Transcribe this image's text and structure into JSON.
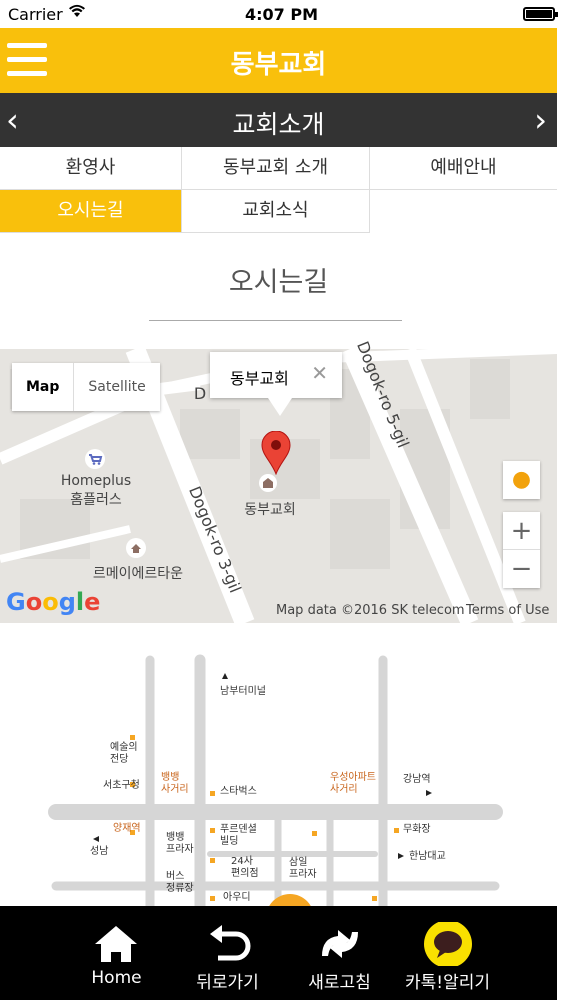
{
  "status_bar": {
    "carrier": "Carrier",
    "time": "4:07 PM"
  },
  "app_bar": {
    "title": "동부교회"
  },
  "sub_bar": {
    "title": "교회소개",
    "prev": "‹",
    "next": "›"
  },
  "tabs": [
    {
      "label": "환영사",
      "active": false
    },
    {
      "label": "동부교회 소개",
      "active": false
    },
    {
      "label": "예배안내",
      "active": false
    },
    {
      "label": "오시는길",
      "active": true
    },
    {
      "label": "교회소식",
      "active": false
    }
  ],
  "section": {
    "title": "오시는길"
  },
  "map": {
    "type_buttons": {
      "map": "Map",
      "satellite": "Satellite"
    },
    "info_window": {
      "name": "동부교회",
      "close": "✕"
    },
    "marker_label": "동부교회",
    "poi": {
      "homeplus_en": "Homeplus",
      "homeplus_ko": "홈플러스",
      "remei": "르메이에르타운"
    },
    "streets": {
      "s1": "Dogok-ro 3-gil",
      "s2": "Dogok-ro 5-gil",
      "s3": "D"
    },
    "zoom_in": "+",
    "zoom_out": "−",
    "google_logo": "Google",
    "attribution": "Map data ©2016 SK telecom",
    "terms": "Terms of Use"
  },
  "directions": {
    "labels": {
      "nambu": "남부터미널",
      "arts": "예술의\n전당",
      "seocho": "서초구청",
      "ppyeong_cross": "뱅뱅\n사거리",
      "starbucks": "스타벅스",
      "wooseong": "우성아파트\n사거리",
      "gangnam": "강남역",
      "yangjae": "양재역",
      "seongnam": "성남",
      "ppyeong_plaza": "뱅뱅\n프라자",
      "prudential": "푸르덴셜\n빌딩",
      "muhwajang": "무화장",
      "hannam": "한남대교",
      "conv": "24사\n편의점",
      "samil": "삼일\n프라자",
      "bus": "버스\n정류장",
      "audi": "아우디"
    }
  },
  "bottom_nav": [
    {
      "label": "Home",
      "icon": "home-icon"
    },
    {
      "label": "뒤로가기",
      "icon": "back-icon"
    },
    {
      "label": "새로고침",
      "icon": "refresh-icon"
    },
    {
      "label": "카톡!알리기",
      "icon": "kakaotalk-icon"
    }
  ],
  "colors": {
    "accent": "#f9c00c",
    "dark_bar": "#333333",
    "kakao_yellow": "#f9e000"
  }
}
